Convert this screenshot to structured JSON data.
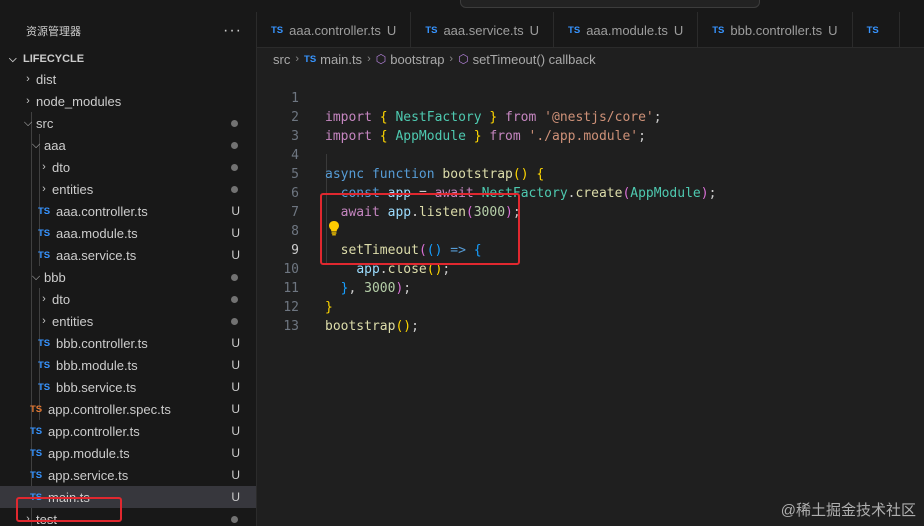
{
  "explorer": {
    "title": "资源管理器",
    "more": "···",
    "project": "LIFECYCLE",
    "items": [
      {
        "label": "dist",
        "badge": ""
      },
      {
        "label": "node_modules",
        "badge": ""
      },
      {
        "label": "src",
        "badge": ""
      },
      {
        "label": "aaa",
        "badge": ""
      },
      {
        "label": "dto",
        "badge": ""
      },
      {
        "label": "entities",
        "badge": ""
      },
      {
        "label": "aaa.controller.ts",
        "badge": "U"
      },
      {
        "label": "aaa.module.ts",
        "badge": "U"
      },
      {
        "label": "aaa.service.ts",
        "badge": "U"
      },
      {
        "label": "bbb",
        "badge": ""
      },
      {
        "label": "dto",
        "badge": ""
      },
      {
        "label": "entities",
        "badge": ""
      },
      {
        "label": "bbb.controller.ts",
        "badge": "U"
      },
      {
        "label": "bbb.module.ts",
        "badge": "U"
      },
      {
        "label": "bbb.service.ts",
        "badge": "U"
      },
      {
        "label": "app.controller.spec.ts",
        "badge": "U"
      },
      {
        "label": "app.controller.ts",
        "badge": "U"
      },
      {
        "label": "app.module.ts",
        "badge": "U"
      },
      {
        "label": "app.service.ts",
        "badge": "U"
      },
      {
        "label": "main.ts",
        "badge": "U"
      },
      {
        "label": "test",
        "badge": ""
      }
    ]
  },
  "tabs": [
    {
      "label": "aaa.controller.ts",
      "badge": "U"
    },
    {
      "label": "aaa.service.ts",
      "badge": "U"
    },
    {
      "label": "aaa.module.ts",
      "badge": "U"
    },
    {
      "label": "bbb.controller.ts",
      "badge": "U"
    },
    {
      "label": "TS",
      "badge": ""
    }
  ],
  "file_icon": "TS",
  "breadcrumb": [
    "src",
    "main.ts",
    "bootstrap",
    "setTimeout() callback"
  ],
  "editor": {
    "line_numbers": [
      "1",
      "2",
      "3",
      "4",
      "5",
      "6",
      "7",
      "8",
      "9",
      "10",
      "11",
      "12",
      "13"
    ],
    "active_line": "9"
  },
  "watermark": "@稀土掘金技术社区",
  "colors": {
    "highlight_box": "#e0282f",
    "ts_icon": "#3794ff",
    "spec_icon": "#e37933"
  }
}
